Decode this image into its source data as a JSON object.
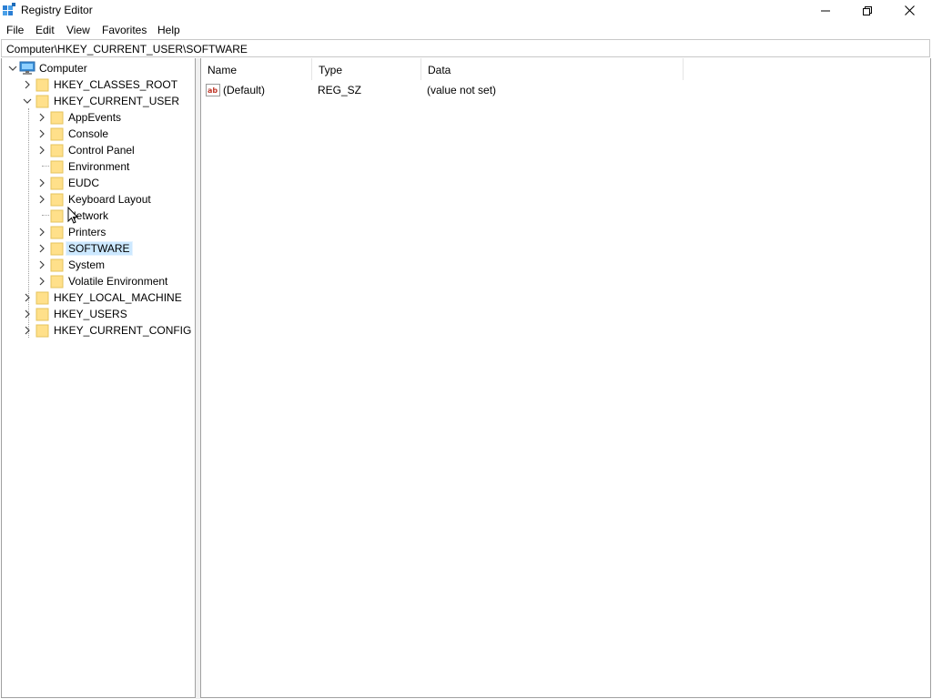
{
  "window": {
    "title": "Registry Editor",
    "controls": {
      "minimize": "minimize-icon",
      "maximize": "restore-icon",
      "close": "close-icon"
    }
  },
  "menu": [
    "File",
    "Edit",
    "View",
    "Favorites",
    "Help"
  ],
  "address": "Computer\\HKEY_CURRENT_USER\\SOFTWARE",
  "tree": {
    "root": "Computer",
    "hives": [
      {
        "label": "HKEY_CLASSES_ROOT",
        "expanded": false
      },
      {
        "label": "HKEY_CURRENT_USER",
        "expanded": true
      },
      {
        "label": "HKEY_LOCAL_MACHINE",
        "expanded": false
      },
      {
        "label": "HKEY_USERS",
        "expanded": false
      },
      {
        "label": "HKEY_CURRENT_CONFIG",
        "expanded": false
      }
    ],
    "current_user_children": [
      {
        "label": "AppEvents",
        "has_children": true
      },
      {
        "label": "Console",
        "has_children": true
      },
      {
        "label": "Control Panel",
        "has_children": true
      },
      {
        "label": "Environment",
        "has_children": false
      },
      {
        "label": "EUDC",
        "has_children": true
      },
      {
        "label": "Keyboard Layout",
        "has_children": true
      },
      {
        "label": "Network",
        "has_children": false
      },
      {
        "label": "Printers",
        "has_children": true
      },
      {
        "label": "SOFTWARE",
        "has_children": true,
        "selected": true
      },
      {
        "label": "System",
        "has_children": true
      },
      {
        "label": "Volatile Environment",
        "has_children": true
      }
    ]
  },
  "values": {
    "columns": [
      "Name",
      "Type",
      "Data"
    ],
    "rows": [
      {
        "name": "(Default)",
        "type": "REG_SZ",
        "data": "(value not set)",
        "icon": "string-value-icon"
      }
    ]
  },
  "colors": {
    "selection": "#cce8ff",
    "folder": "#ffe08a",
    "computer": "#3a8fd8"
  }
}
